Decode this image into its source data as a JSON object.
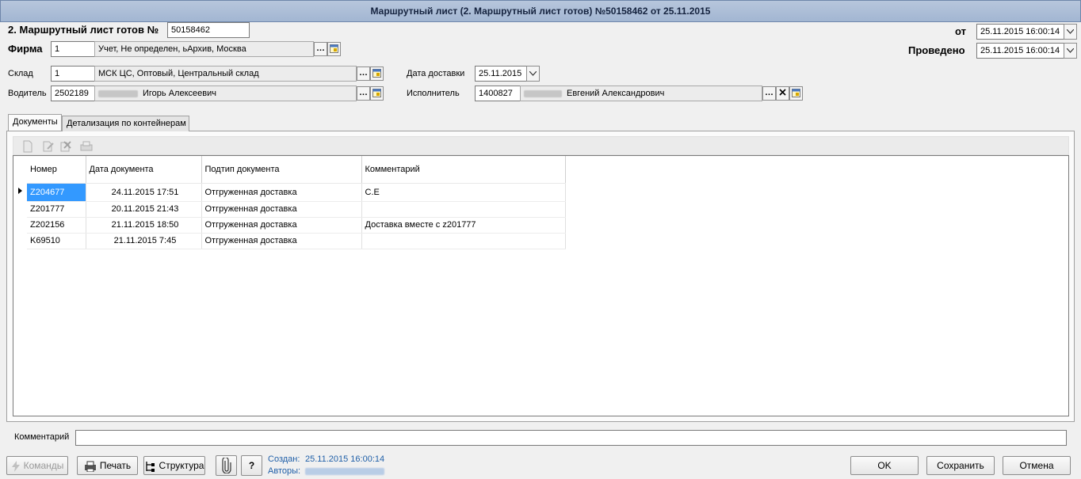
{
  "window": {
    "title": "Маршрутный лист (2. Маршрутный лист готов) №50158462 от 25.11.2015"
  },
  "header": {
    "doc_label": "2. Маршрутный лист готов №",
    "doc_number": "50158462",
    "date_label": "от",
    "date_value": "25.11.2015 16:00:14",
    "posted_label": "Проведено",
    "posted_value": "25.11.2015 16:00:14",
    "firm_label": "Фирма",
    "firm_code": "1",
    "firm_name": "Учет, Не определен, ьАрхив, Москва"
  },
  "fields": {
    "warehouse_label": "Склад",
    "warehouse_code": "1",
    "warehouse_name": "МСК ЦС, Оптовый, Центральный склад",
    "driver_label": "Водитель",
    "driver_code": "2502189",
    "driver_name": "Игорь Алексеевич",
    "delivery_date_label": "Дата доставки",
    "delivery_date_value": "25.11.2015",
    "executor_label": "Исполнитель",
    "executor_code": "1400827",
    "executor_name": "Евгений Александрович"
  },
  "tabs": [
    {
      "label": "Документы"
    },
    {
      "label": "Детализация по контейнерам"
    }
  ],
  "grid": {
    "columns": [
      "Номер",
      "Дата документа",
      "Подтип документа",
      "Комментарий"
    ],
    "rows": [
      [
        "Z204677",
        "24.11.2015 17:51",
        "Отгруженная доставка",
        "С.Е"
      ],
      [
        "Z201777",
        "20.11.2015 21:43",
        "Отгруженная доставка",
        ""
      ],
      [
        "Z202156",
        "21.11.2015 18:50",
        "Отгруженная доставка",
        "Доставка вместе с z201777"
      ],
      [
        "K69510",
        "21.11.2015 7:45",
        "Отгруженная доставка",
        ""
      ]
    ]
  },
  "comment": {
    "label": "Комментарий",
    "value": ""
  },
  "footer": {
    "commands_label": "Команды",
    "print_label": "Печать",
    "structure_label": "Структура",
    "help_label": "?",
    "created_label": "Создан:",
    "created_value": "25.11.2015 16:00:14",
    "authors_label": "Авторы:",
    "ok_label": "OK",
    "save_label": "Сохранить",
    "cancel_label": "Отмена"
  },
  "colors": {
    "selection": "#3399ff",
    "titlebar": "#a2b6d2",
    "info_text": "#1f5fa8"
  }
}
